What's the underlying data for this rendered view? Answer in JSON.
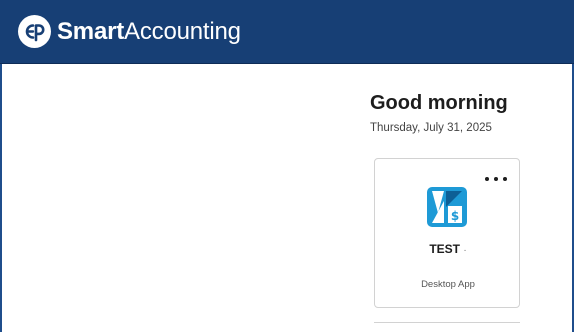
{
  "header": {
    "brand_strong": "Smart",
    "brand_light": "Accounting",
    "logo_icon": "smartaccounting-logo-icon",
    "background": "#173f75"
  },
  "main": {
    "greeting": "Good morning",
    "date": "Thursday, July 31, 2025"
  },
  "app_card": {
    "name": "TEST",
    "name_suffix": "·",
    "type": "Desktop App",
    "icon": "accounting-app-icon",
    "menu_icon": "more-options-icon",
    "icon_color": "#1e9ad6"
  }
}
